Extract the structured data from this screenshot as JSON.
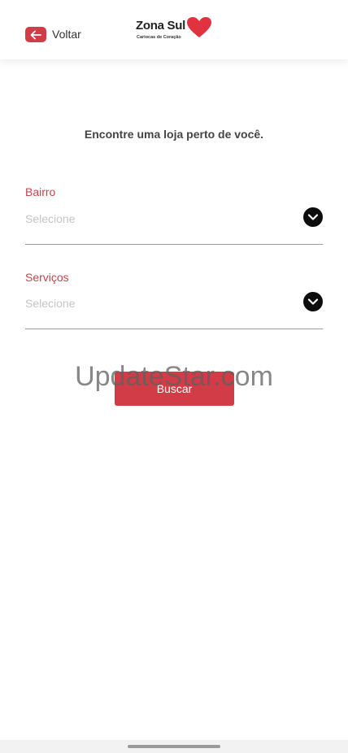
{
  "header": {
    "back_label": "Voltar",
    "logo": {
      "name": "Zona Sul",
      "tagline": "Cariocas de Coração"
    }
  },
  "main": {
    "headline": "Encontre uma loja perto de você.",
    "fields": [
      {
        "label": "Bairro",
        "placeholder": "Selecione"
      },
      {
        "label": "Serviços",
        "placeholder": "Selecione"
      }
    ],
    "submit_label": "Buscar"
  },
  "watermark": "UpdateStar.com",
  "colors": {
    "accent": "#d23c46",
    "label": "#c0454e",
    "chevron_bg": "#0d0d0d"
  },
  "icons": {
    "back": "arrow-left-icon",
    "logo_mark": "heart-icon",
    "dropdown": "chevron-down-icon"
  }
}
